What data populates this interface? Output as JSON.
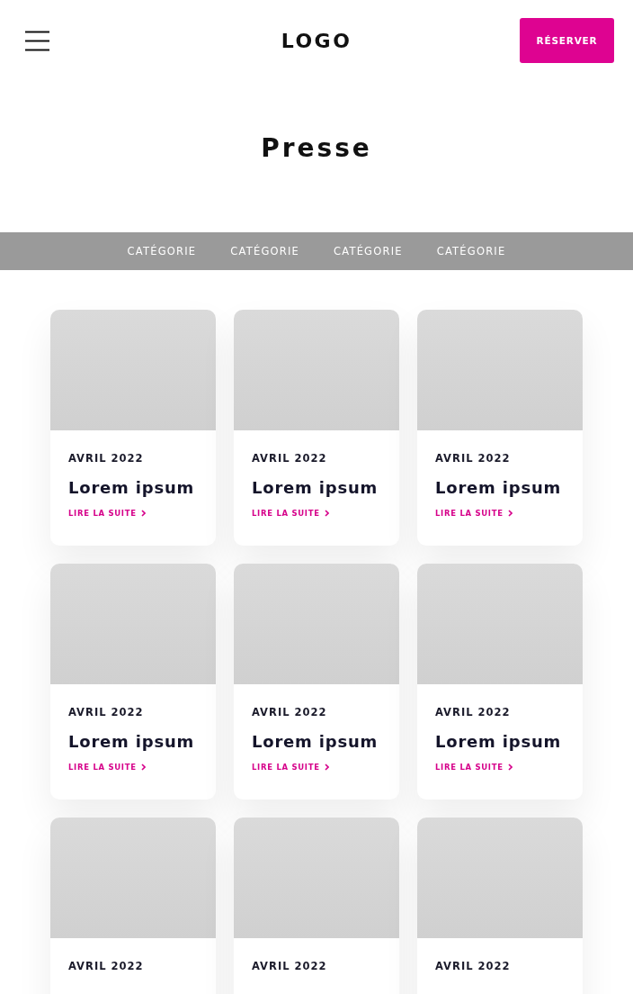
{
  "header": {
    "logo": "LOGO",
    "cta": "RÉSERVER"
  },
  "page_title": "Presse",
  "categories": [
    {
      "label": "CATÉGORIE"
    },
    {
      "label": "CATÉGORIE"
    },
    {
      "label": "CATÉGORIE"
    },
    {
      "label": "CATÉGORIE"
    }
  ],
  "articles": [
    {
      "date": "AVRIL 2022",
      "title": "Lorem ipsum",
      "link": "LIRE LA SUITE"
    },
    {
      "date": "AVRIL 2022",
      "title": "Lorem ipsum",
      "link": "LIRE LA SUITE"
    },
    {
      "date": "AVRIL 2022",
      "title": "Lorem ipsum",
      "link": "LIRE LA SUITE"
    },
    {
      "date": "AVRIL 2022",
      "title": "Lorem ipsum",
      "link": "LIRE LA SUITE"
    },
    {
      "date": "AVRIL 2022",
      "title": "Lorem ipsum",
      "link": "LIRE LA SUITE"
    },
    {
      "date": "AVRIL 2022",
      "title": "Lorem ipsum",
      "link": "LIRE LA SUITE"
    },
    {
      "date": "AVRIL 2022"
    },
    {
      "date": "AVRIL 2022"
    },
    {
      "date": "AVRIL 2022"
    }
  ]
}
